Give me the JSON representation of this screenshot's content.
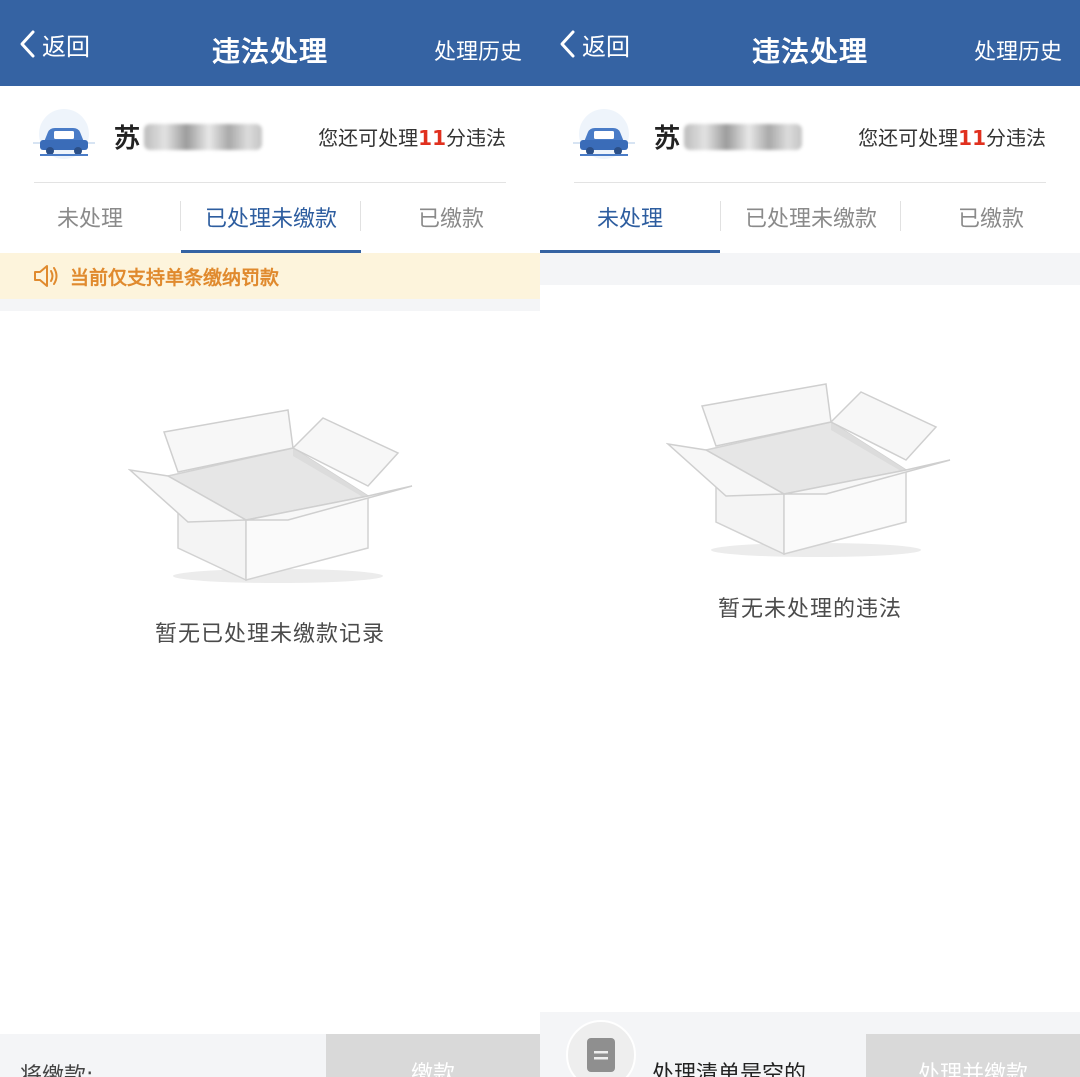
{
  "left": {
    "nav": {
      "back_label": "返回",
      "title": "违法处理",
      "history_label": "处理历史"
    },
    "vehicle": {
      "plate_prefix": "苏",
      "quota_prefix": "您还可处理",
      "quota_points": "11",
      "quota_suffix": "分违法"
    },
    "tabs": [
      {
        "label": "未处理",
        "active": false
      },
      {
        "label": "已处理未缴款",
        "active": true
      },
      {
        "label": "已缴款",
        "active": false
      }
    ],
    "notice": "当前仅支持单条缴纳罚款",
    "empty_text": "暂无已处理未缴款记录",
    "bottom": {
      "amount_label": "将缴款:",
      "pay_label": "缴款"
    }
  },
  "right": {
    "nav": {
      "back_label": "返回",
      "title": "违法处理",
      "history_label": "处理历史"
    },
    "vehicle": {
      "plate_prefix": "苏",
      "quota_prefix": "您还可处理",
      "quota_points": "11",
      "quota_suffix": "分违法"
    },
    "tabs": [
      {
        "label": "未处理",
        "active": true
      },
      {
        "label": "已处理未缴款",
        "active": false
      },
      {
        "label": "已缴款",
        "active": false
      }
    ],
    "empty_text": "暂无未处理的违法",
    "bottom": {
      "list_label": "处理清单是空的",
      "submit_label": "处理并缴款"
    }
  },
  "colors": {
    "nav_bg": "#3563a3",
    "accent": "#2d5d9f",
    "points_red": "#e0301e",
    "notice_text": "#e08a2e",
    "notice_bg": "#fdf4dc"
  },
  "icons": [
    "back-chevron-icon",
    "car-icon",
    "speaker-icon",
    "empty-box-icon",
    "list-document-icon"
  ]
}
